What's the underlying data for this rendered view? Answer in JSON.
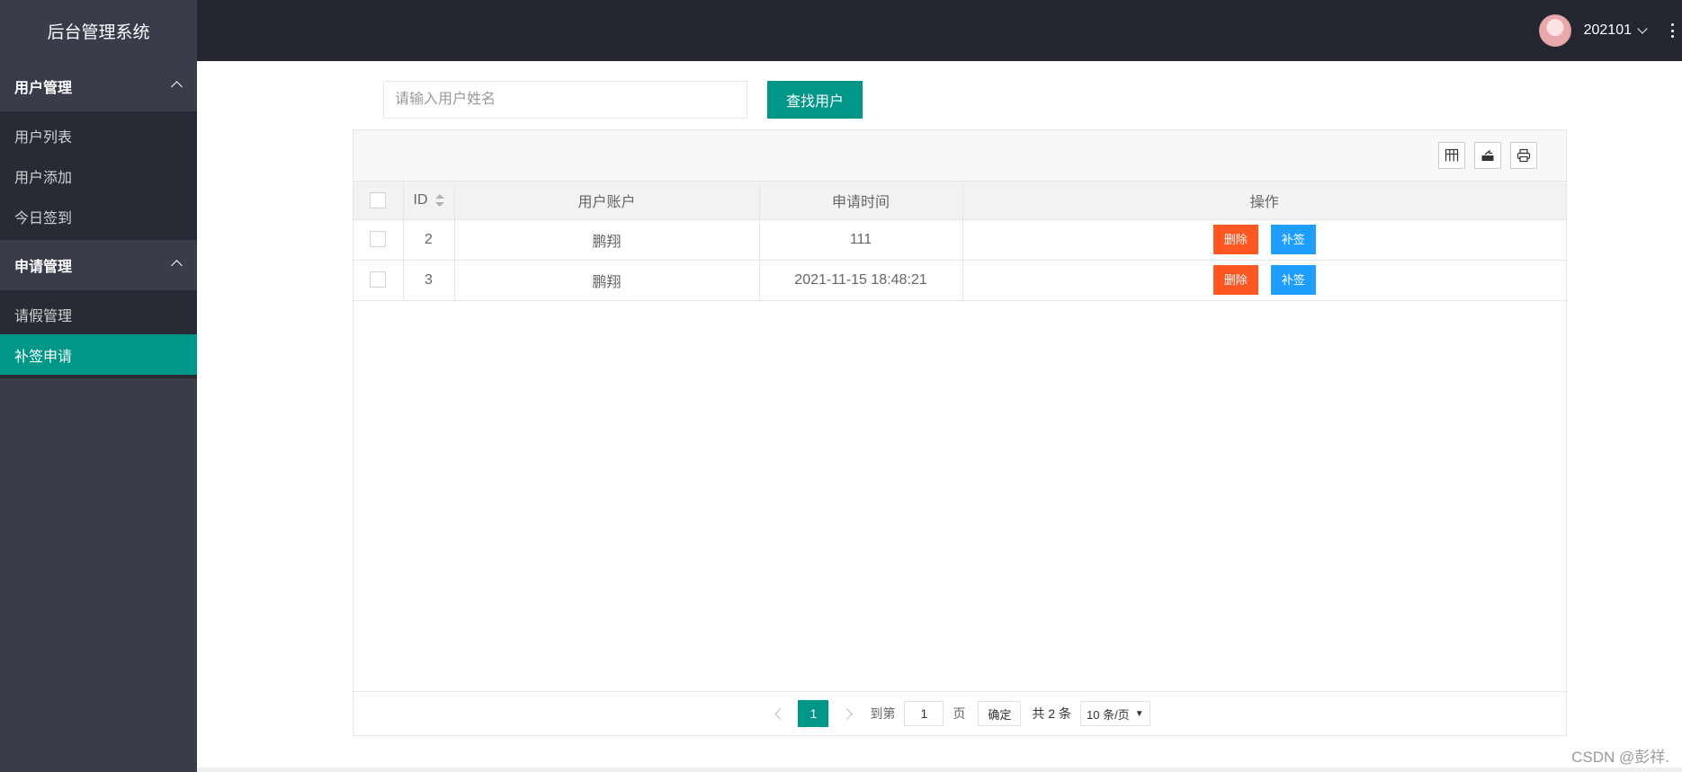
{
  "header": {
    "logo": "后台管理系统",
    "username": "202101"
  },
  "sidebar": {
    "groups": [
      {
        "title": "用户管理",
        "items": [
          "用户列表",
          "用户添加",
          "今日签到"
        ]
      },
      {
        "title": "申请管理",
        "items": [
          "请假管理",
          "补签申请"
        ]
      }
    ],
    "active": "补签申请"
  },
  "search": {
    "placeholder": "请输入用户姓名",
    "button": "查找用户"
  },
  "table": {
    "columns": [
      "ID",
      "用户账户",
      "申请时间",
      "操作"
    ],
    "rows": [
      {
        "id": "2",
        "account": "鹏翔",
        "time": "111"
      },
      {
        "id": "3",
        "account": "鹏翔",
        "time": "2021-11-15 18:48:21"
      }
    ],
    "actions": {
      "delete": "删除",
      "resign": "补签"
    }
  },
  "pagination": {
    "current": "1",
    "goto_label": "到第",
    "goto_value": "1",
    "page_unit": "页",
    "confirm": "确定",
    "total": "共 2 条",
    "limit": "10 条/页"
  },
  "watermark": "CSDN @彭祥."
}
